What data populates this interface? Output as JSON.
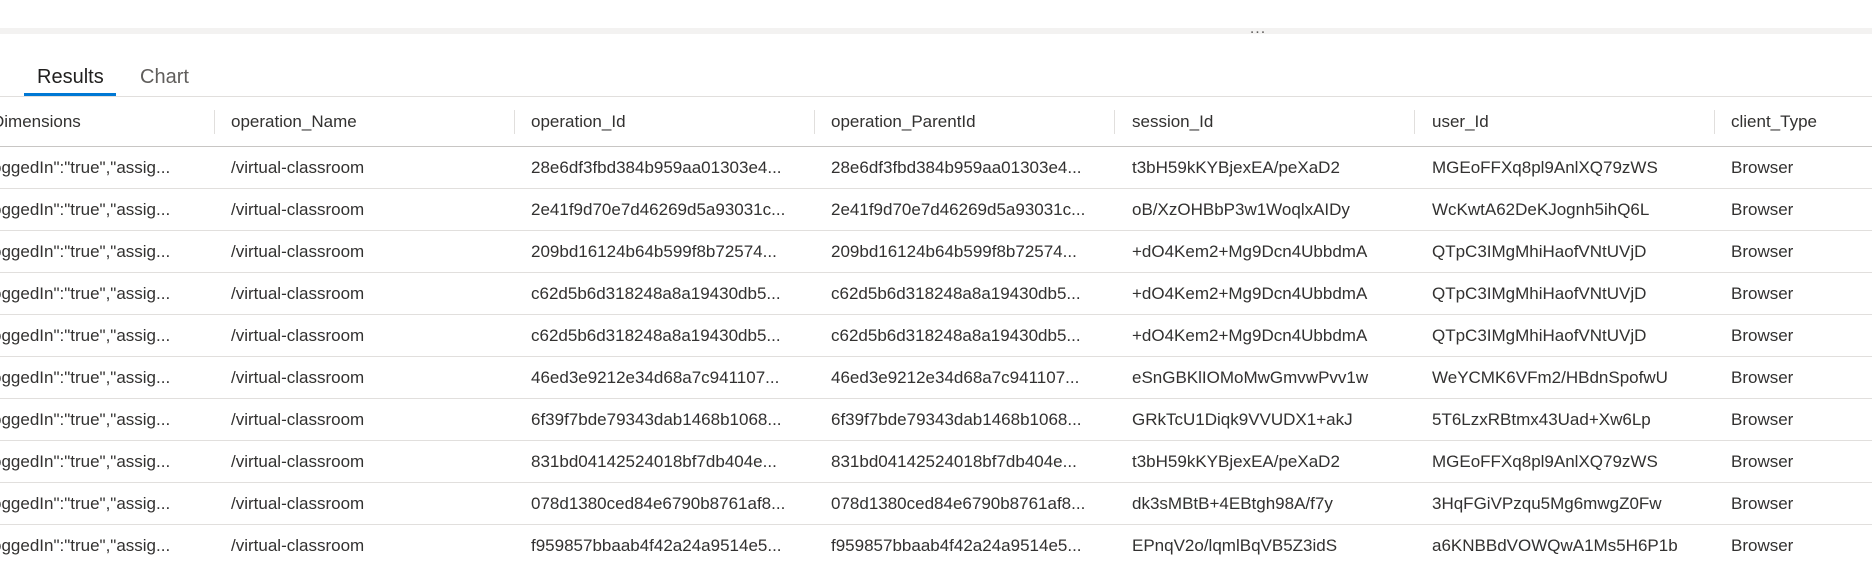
{
  "splitter": {
    "label": "..."
  },
  "tabs": [
    {
      "label": "Results",
      "active": true
    },
    {
      "label": "Chart",
      "active": false
    }
  ],
  "table": {
    "columns": [
      "Dimensions",
      "operation_Name",
      "operation_Id",
      "operation_ParentId",
      "session_Id",
      "user_Id",
      "client_Type"
    ],
    "rows": [
      [
        "oggedIn\":\"true\",\"assig...",
        "/virtual-classroom",
        "28e6df3fbd384b959aa01303e4...",
        "28e6df3fbd384b959aa01303e4...",
        "t3bH59kKYBjexEA/peXaD2",
        "MGEoFFXq8pl9AnlXQ79zWS",
        "Browser"
      ],
      [
        "oggedIn\":\"true\",\"assig...",
        "/virtual-classroom",
        "2e41f9d70e7d46269d5a93031c...",
        "2e41f9d70e7d46269d5a93031c...",
        "oB/XzOHBbP3w1WoqlxAIDy",
        "WcKwtA62DeKJognh5ihQ6L",
        "Browser"
      ],
      [
        "oggedIn\":\"true\",\"assig...",
        "/virtual-classroom",
        "209bd16124b64b599f8b72574...",
        "209bd16124b64b599f8b72574...",
        "+dO4Kem2+Mg9Dcn4UbbdmA",
        "QTpC3IMgMhiHaofVNtUVjD",
        "Browser"
      ],
      [
        "oggedIn\":\"true\",\"assig...",
        "/virtual-classroom",
        "c62d5b6d318248a8a19430db5...",
        "c62d5b6d318248a8a19430db5...",
        "+dO4Kem2+Mg9Dcn4UbbdmA",
        "QTpC3IMgMhiHaofVNtUVjD",
        "Browser"
      ],
      [
        "oggedIn\":\"true\",\"assig...",
        "/virtual-classroom",
        "c62d5b6d318248a8a19430db5...",
        "c62d5b6d318248a8a19430db5...",
        "+dO4Kem2+Mg9Dcn4UbbdmA",
        "QTpC3IMgMhiHaofVNtUVjD",
        "Browser"
      ],
      [
        "oggedIn\":\"true\",\"assig...",
        "/virtual-classroom",
        "46ed3e9212e34d68a7c941107...",
        "46ed3e9212e34d68a7c941107...",
        "eSnGBKlIOMoMwGmvwPvv1w",
        "WeYCMK6VFm2/HBdnSpofwU",
        "Browser"
      ],
      [
        "oggedIn\":\"true\",\"assig...",
        "/virtual-classroom",
        "6f39f7bde79343dab1468b1068...",
        "6f39f7bde79343dab1468b1068...",
        "GRkTcU1Diqk9VVUDX1+akJ",
        "5T6LzxRBtmx43Uad+Xw6Lp",
        "Browser"
      ],
      [
        "oggedIn\":\"true\",\"assig...",
        "/virtual-classroom",
        "831bd04142524018bf7db404e...",
        "831bd04142524018bf7db404e...",
        "t3bH59kKYBjexEA/peXaD2",
        "MGEoFFXq8pl9AnlXQ79zWS",
        "Browser"
      ],
      [
        "oggedIn\":\"true\",\"assig...",
        "/virtual-classroom",
        "078d1380ced84e6790b8761af8...",
        "078d1380ced84e6790b8761af8...",
        "dk3sMBtB+4EBtgh98A/f7y",
        "3HqFGiVPzqu5Mg6mwgZ0Fw",
        "Browser"
      ],
      [
        "oggedIn\":\"true\",\"assig...",
        "/virtual-classroom",
        "f959857bbaab4f42a24a9514e5...",
        "f959857bbaab4f42a24a9514e5...",
        "EPnqV2o/lqmlBqVB5Z3idS",
        "a6KNBBdVOWQwA1Ms5H6P1b",
        "Browser"
      ]
    ]
  },
  "colors": {
    "accent": "#0078d4",
    "text": "#323130",
    "border": "#e1dfdd"
  }
}
